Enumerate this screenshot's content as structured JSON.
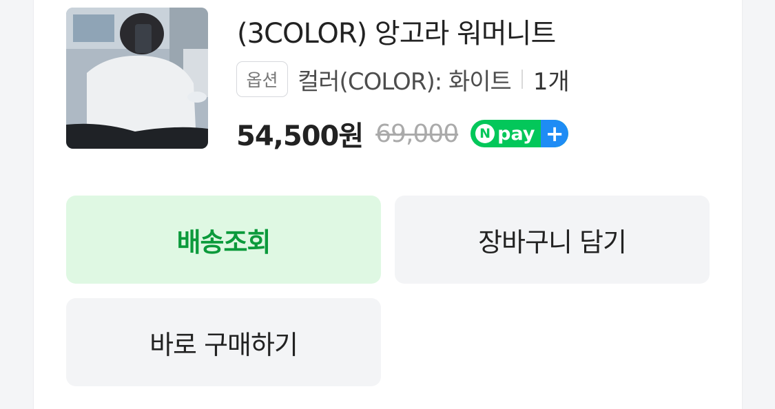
{
  "product": {
    "title": "(3COLOR) 앙고라 워머니트",
    "option_label": "옵션",
    "option_value": "컬러(COLOR): 화이트",
    "quantity": "1개",
    "price": "54,500원",
    "original_price": "69,000",
    "npay_n": "N",
    "npay_text": "pay",
    "npay_plus": "+"
  },
  "buttons": {
    "track": "배송조회",
    "cart": "장바구니 담기",
    "buy": "바로 구매하기"
  },
  "colors": {
    "accent_green": "#03c75a",
    "track_text": "#0b9a3b",
    "track_bg": "#dff8e3",
    "npay_plus_blue": "#1e8cf5"
  }
}
